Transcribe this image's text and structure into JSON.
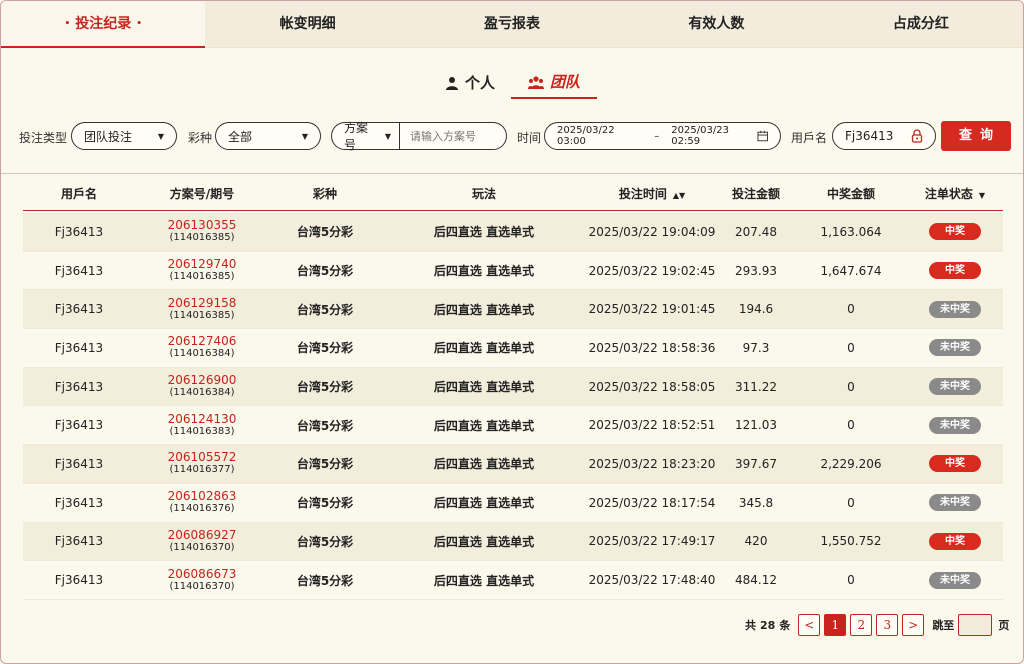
{
  "top_tabs": [
    {
      "label": "投注纪录",
      "active": true
    },
    {
      "label": "帐变明细",
      "active": false
    },
    {
      "label": "盈亏报表",
      "active": false
    },
    {
      "label": "有效人数",
      "active": false
    },
    {
      "label": "占成分红",
      "active": false
    }
  ],
  "sub_tabs": {
    "personal": "个人",
    "team": "团队"
  },
  "filters": {
    "bet_type_label": "投注类型",
    "bet_type_value": "团队投注",
    "lottery_label": "彩种",
    "lottery_value": "全部",
    "plan_select": "方案号",
    "plan_placeholder": "请输入方案号",
    "time_label": "时间",
    "time_start": "2025/03/22 03:00",
    "time_sep": "–",
    "time_end": "2025/03/23 02:59",
    "username_label": "用戶名",
    "username_value": "Fj36413",
    "query_button": "查询"
  },
  "table": {
    "headers": [
      "用戶名",
      "方案号/期号",
      "彩种",
      "玩法",
      "投注时间",
      "投注金额",
      "中奖金额",
      "注单状态"
    ],
    "rows": [
      {
        "user": "Fj36413",
        "plan": "206130355",
        "issue": "(114016385)",
        "lottery": "台湾5分彩",
        "play": "后四直选 直选单式",
        "time": "2025/03/22 19:04:09",
        "bet": "207.48",
        "win": "1,163.064",
        "status": "中奖",
        "won": true
      },
      {
        "user": "Fj36413",
        "plan": "206129740",
        "issue": "(114016385)",
        "lottery": "台湾5分彩",
        "play": "后四直选 直选单式",
        "time": "2025/03/22 19:02:45",
        "bet": "293.93",
        "win": "1,647.674",
        "status": "中奖",
        "won": true
      },
      {
        "user": "Fj36413",
        "plan": "206129158",
        "issue": "(114016385)",
        "lottery": "台湾5分彩",
        "play": "后四直选 直选单式",
        "time": "2025/03/22 19:01:45",
        "bet": "194.6",
        "win": "0",
        "status": "未中奖",
        "won": false
      },
      {
        "user": "Fj36413",
        "plan": "206127406",
        "issue": "(114016384)",
        "lottery": "台湾5分彩",
        "play": "后四直选 直选单式",
        "time": "2025/03/22 18:58:36",
        "bet": "97.3",
        "win": "0",
        "status": "未中奖",
        "won": false
      },
      {
        "user": "Fj36413",
        "plan": "206126900",
        "issue": "(114016384)",
        "lottery": "台湾5分彩",
        "play": "后四直选 直选单式",
        "time": "2025/03/22 18:58:05",
        "bet": "311.22",
        "win": "0",
        "status": "未中奖",
        "won": false
      },
      {
        "user": "Fj36413",
        "plan": "206124130",
        "issue": "(114016383)",
        "lottery": "台湾5分彩",
        "play": "后四直选 直选单式",
        "time": "2025/03/22 18:52:51",
        "bet": "121.03",
        "win": "0",
        "status": "未中奖",
        "won": false
      },
      {
        "user": "Fj36413",
        "plan": "206105572",
        "issue": "(114016377)",
        "lottery": "台湾5分彩",
        "play": "后四直选 直选单式",
        "time": "2025/03/22 18:23:20",
        "bet": "397.67",
        "win": "2,229.206",
        "status": "中奖",
        "won": true
      },
      {
        "user": "Fj36413",
        "plan": "206102863",
        "issue": "(114016376)",
        "lottery": "台湾5分彩",
        "play": "后四直选 直选单式",
        "time": "2025/03/22 18:17:54",
        "bet": "345.8",
        "win": "0",
        "status": "未中奖",
        "won": false
      },
      {
        "user": "Fj36413",
        "plan": "206086927",
        "issue": "(114016370)",
        "lottery": "台湾5分彩",
        "play": "后四直选 直选单式",
        "time": "2025/03/22 17:49:17",
        "bet": "420",
        "win": "1,550.752",
        "status": "中奖",
        "won": true
      },
      {
        "user": "Fj36413",
        "plan": "206086673",
        "issue": "(114016370)",
        "lottery": "台湾5分彩",
        "play": "后四直选 直选单式",
        "time": "2025/03/22 17:48:40",
        "bet": "484.12",
        "win": "0",
        "status": "未中奖",
        "won": false
      }
    ]
  },
  "pager": {
    "total_prefix": "共",
    "total": "28",
    "total_suffix": "条",
    "prev": "<",
    "pages": [
      "1",
      "2",
      "3"
    ],
    "current": "1",
    "next": ">",
    "jump_label": "跳至",
    "page_suffix": "页"
  },
  "colors": {
    "accent": "#c8231c",
    "win_badge": "#d82a1f",
    "lose_badge": "#8a8a8a",
    "background": "#fbf8ec"
  }
}
